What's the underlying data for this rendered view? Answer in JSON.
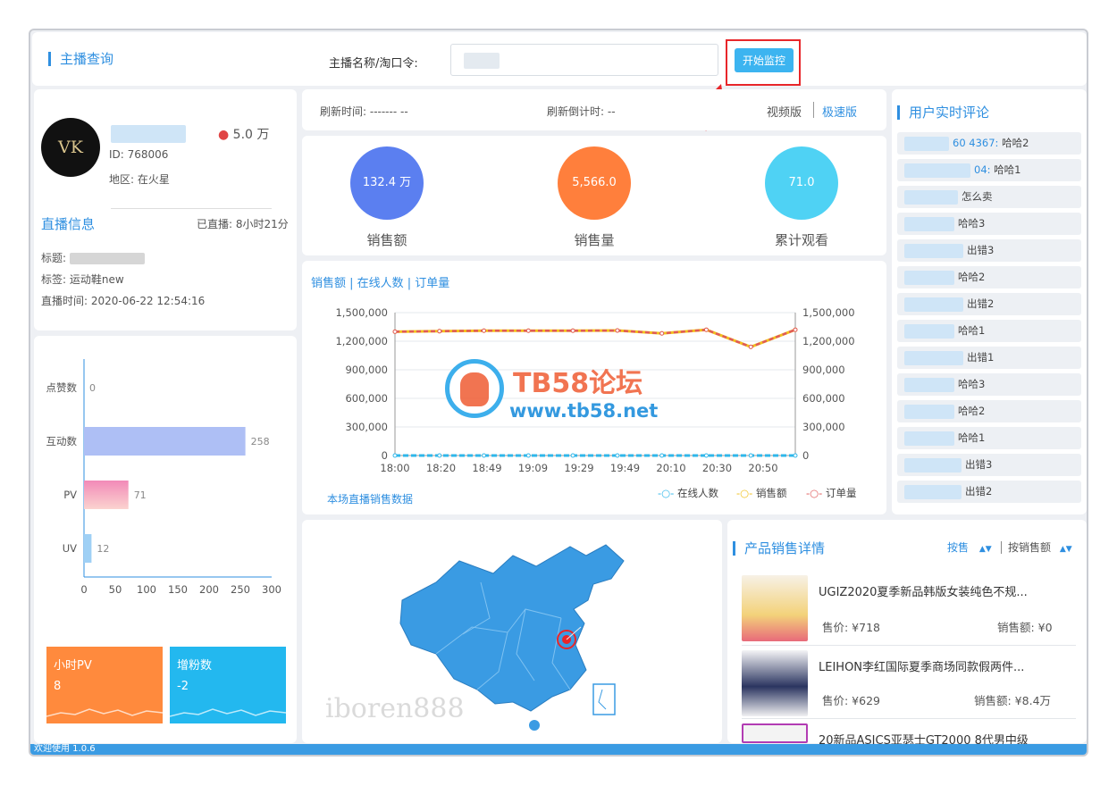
{
  "search": {
    "section_title": "主播查询",
    "field_label": "主播名称/淘口令:",
    "input_value": "",
    "monitor_button": "开始监控"
  },
  "anchor": {
    "avatar_text": "VK",
    "fans": "5.0 万",
    "id_text": "ID: 768006",
    "region_text": "地区: 在火星"
  },
  "live_info": {
    "title": "直播信息",
    "duration": "已直播: 8小时21分",
    "title_label": "标题:",
    "tag_text": "标签: 运动鞋new",
    "time_text": "直播时间: 2020-06-22 12:54:16"
  },
  "refresh": {
    "refresh_time": "刷新时间: ------- --",
    "countdown": "刷新倒计时: --",
    "video_mode": "视频版",
    "fast_mode": "极速版"
  },
  "stats": [
    {
      "value": "132.4 万",
      "label": "销售额",
      "color": "#5b7ff0"
    },
    {
      "value": "5,566.0",
      "label": "销售量",
      "color": "#ff7f3c"
    },
    {
      "value": "71.0",
      "label": "累计观看",
      "color": "#4fd2f4"
    }
  ],
  "main_chart": {
    "title": "销售额 | 在线人数 | 订单量",
    "footer_link": "本场直播销售数据",
    "legend": [
      "在线人数",
      "销售额",
      "订单量"
    ]
  },
  "chart_data": [
    {
      "type": "line",
      "title": "销售额 | 在线人数 | 订单量",
      "x": [
        "18:00",
        "18:20",
        "18:49",
        "19:09",
        "19:29",
        "19:49",
        "20:10",
        "20:30",
        "20:50"
      ],
      "ylim": [
        0,
        1500000
      ],
      "y_ticks": [
        "1,500,000",
        "1,200,000",
        "900,000",
        "600,000",
        "300,000",
        "0"
      ],
      "series": [
        {
          "name": "在线人数",
          "color": "#2fb7ea",
          "values": [
            0,
            0,
            0,
            0,
            0,
            0,
            0,
            0,
            0,
            0
          ]
        },
        {
          "name": "销售额",
          "color": "#f2c21c",
          "values": [
            1300000,
            1305000,
            1310000,
            1310000,
            1310000,
            1312000,
            1282000,
            1320000,
            1140000,
            1320000
          ]
        },
        {
          "name": "订单量",
          "color": "#e05a5a",
          "values": [
            1300000,
            1305000,
            1310000,
            1310000,
            1310000,
            1312000,
            1282000,
            1320000,
            1140000,
            1320000
          ]
        }
      ],
      "grid": true,
      "legend_position": "bottom-right"
    },
    {
      "type": "bar",
      "orientation": "horizontal",
      "categories": [
        "点赞数",
        "互动数",
        "PV",
        "UV"
      ],
      "values": [
        0,
        258,
        71,
        12
      ],
      "x_ticks": [
        "0",
        "50",
        "100",
        "150",
        "200",
        "250",
        "300"
      ],
      "xlim": [
        0,
        300
      ]
    }
  ],
  "tiles": [
    {
      "label": "小时PV",
      "value": "8",
      "color": "#ff8a3d"
    },
    {
      "label": "增粉数",
      "value": "-2",
      "color": "#23b8ef"
    }
  ],
  "comments": {
    "title": "用户实时评论",
    "items": [
      {
        "user": "60 4367:",
        "text": "哈哈2"
      },
      {
        "user": "04:",
        "text": "哈哈1"
      },
      {
        "user": "",
        "text": "怎么卖"
      },
      {
        "user": "",
        "text": "哈哈3"
      },
      {
        "user": "",
        "text": "出错3"
      },
      {
        "user": "",
        "text": "哈哈2"
      },
      {
        "user": "",
        "text": "出错2"
      },
      {
        "user": "",
        "text": "哈哈1"
      },
      {
        "user": "",
        "text": "出错1"
      },
      {
        "user": "",
        "text": "哈哈3"
      },
      {
        "user": "",
        "text": "哈哈2"
      },
      {
        "user": "",
        "text": "哈哈1"
      },
      {
        "user": "",
        "text": "出错3"
      },
      {
        "user": "",
        "text": "出错2"
      }
    ]
  },
  "products": {
    "title": "产品销售详情",
    "sort_by_sales": "按售",
    "sort_by_amount": "按销售额",
    "items": [
      {
        "name": "UGIZ2020夏季新品韩版女装纯色不规...",
        "price": "售价: ¥718",
        "sales": "销售额: ¥0"
      },
      {
        "name": "LEIHON李红国际夏季商场同款假两件...",
        "price": "售价: ¥629",
        "sales": "销售额: ¥8.4万"
      },
      {
        "name": "20新品ASICS亚瑟士GT2000 8代男中级",
        "price": "",
        "sales": ""
      }
    ]
  },
  "watermark": {
    "logo_text": "TB58论坛",
    "url": "www.tb58.net",
    "bottom_text": "iboren888"
  },
  "footer": {
    "version": "欢迎使用 1.0.6"
  }
}
